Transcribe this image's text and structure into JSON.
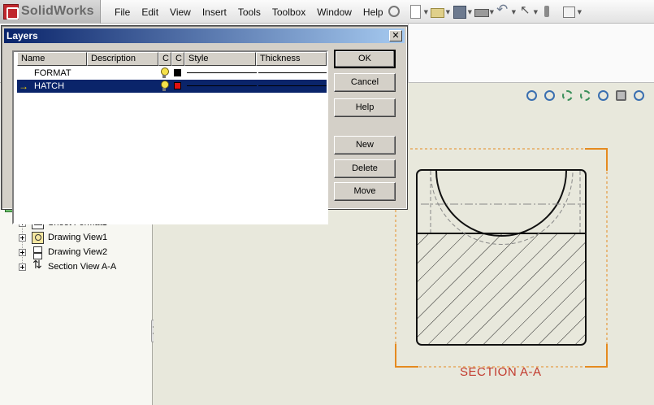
{
  "app": {
    "name": "SolidWorks"
  },
  "menu": [
    "File",
    "Edit",
    "View",
    "Insert",
    "Tools",
    "Toolbox",
    "Window",
    "Help"
  ],
  "toolbar_icons": [
    "pin-icon",
    "new-document-icon",
    "open-folder-icon",
    "save-icon",
    "print-icon",
    "undo-icon",
    "select-cursor-icon",
    "traffic-light-icon",
    "options-icon"
  ],
  "view_icons": [
    "zoom-to-fit-icon",
    "zoom-to-area-icon",
    "pan-icon",
    "rotate-icon",
    "zoom-in-out-icon",
    "display-style-icon",
    "more-icon"
  ],
  "tree": {
    "items": [
      {
        "label": "Sheet Format1",
        "icon": "sheet-format-icon"
      },
      {
        "label": "Drawing View1",
        "icon": "drawing-view-icon"
      },
      {
        "label": "Drawing View2",
        "icon": "drawing-view-icon"
      },
      {
        "label": "Section View A-A",
        "icon": "section-view-icon"
      }
    ]
  },
  "drawing": {
    "section_label": "SECTION A-A"
  },
  "dialog": {
    "title": "Layers",
    "close": "✕",
    "columns": [
      "Name",
      "Description",
      "C",
      "C",
      "Style",
      "Thickness"
    ],
    "rows": [
      {
        "name": "FORMAT",
        "description": "",
        "color": "#000000",
        "active": false,
        "selected": false
      },
      {
        "name": "HATCH",
        "description": "",
        "color": "#e01010",
        "active": true,
        "selected": true
      }
    ],
    "buttons": {
      "ok": "OK",
      "cancel": "Cancel",
      "help": "Help",
      "new": "New",
      "delete": "Delete",
      "move": "Move"
    }
  }
}
